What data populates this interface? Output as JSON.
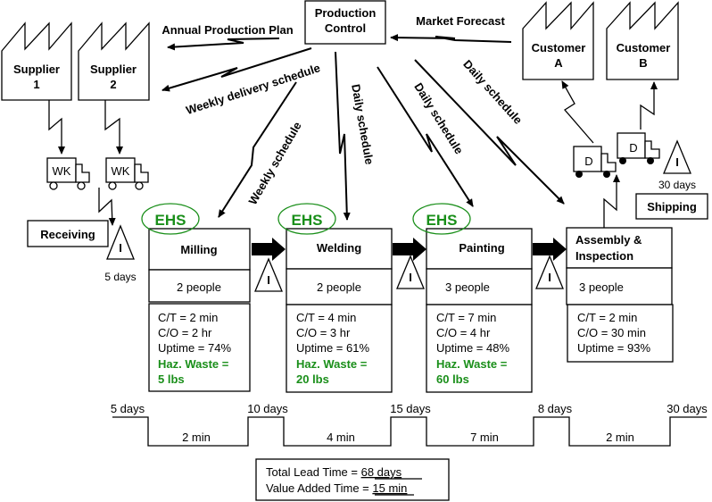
{
  "production_control": {
    "line1": "Production",
    "line2": "Control"
  },
  "suppliers": [
    {
      "line1": "Supplier",
      "line2": "1",
      "truck_label": "WK"
    },
    {
      "line1": "Supplier",
      "line2": "2",
      "truck_label": "WK"
    }
  ],
  "customers": [
    {
      "line1": "Customer",
      "line2": "A",
      "truck_label": "D"
    },
    {
      "line1": "Customer",
      "line2": "B",
      "truck_label": "D"
    }
  ],
  "info_flows": {
    "annual_plan": "Annual Production Plan",
    "market_forecast": "Market Forecast",
    "weekly_delivery": "Weekly delivery schedule",
    "weekly_schedule": "Weekly schedule",
    "daily_welding": "Daily schedule",
    "daily_painting": "Daily schedule",
    "daily_assembly": "Daily schedule"
  },
  "receiving": {
    "label": "Receiving",
    "inventory_symbol": "I",
    "inventory_days": "5 days"
  },
  "shipping": {
    "label": "Shipping",
    "inventory_symbol": "I",
    "inventory_days": "30 days"
  },
  "ehs_label": "EHS",
  "processes": [
    {
      "name": "Milling",
      "people": "2 people",
      "ct": "C/T = 2 min",
      "co": "C/O = 2 hr",
      "uptime": "Uptime = 74%",
      "waste_label": "Haz. Waste =",
      "waste_value": "5 lbs"
    },
    {
      "name": "Welding",
      "people": "2 people",
      "ct": "C/T = 4 min",
      "co": "C/O = 3 hr",
      "uptime": "Uptime = 61%",
      "waste_label": "Haz. Waste =",
      "waste_value": "20 lbs"
    },
    {
      "name": "Painting",
      "people": "3 people",
      "ct": "C/T = 7 min",
      "co": "C/O = 4 hr",
      "uptime": "Uptime = 48%",
      "waste_label": "Haz. Waste =",
      "waste_value": "60 lbs"
    },
    {
      "name_line1": "Assembly &",
      "name_line2": "Inspection",
      "people": "3 people",
      "ct": "C/T = 2 min",
      "co": "C/O = 30 min",
      "uptime": "Uptime = 93%"
    }
  ],
  "inventory_symbol": "I",
  "timeline": {
    "wait_times": [
      "5 days",
      "10 days",
      "15 days",
      "8 days",
      "30 days"
    ],
    "process_times": [
      "2 min",
      "4 min",
      "7 min",
      "2 min"
    ]
  },
  "summary": {
    "lead_label": "Total Lead Time = ",
    "lead_value": "68 days",
    "va_label": "Value Added Time = ",
    "va_value": "15 min"
  },
  "colors": {
    "ehs_green": "#1a8f1a"
  }
}
